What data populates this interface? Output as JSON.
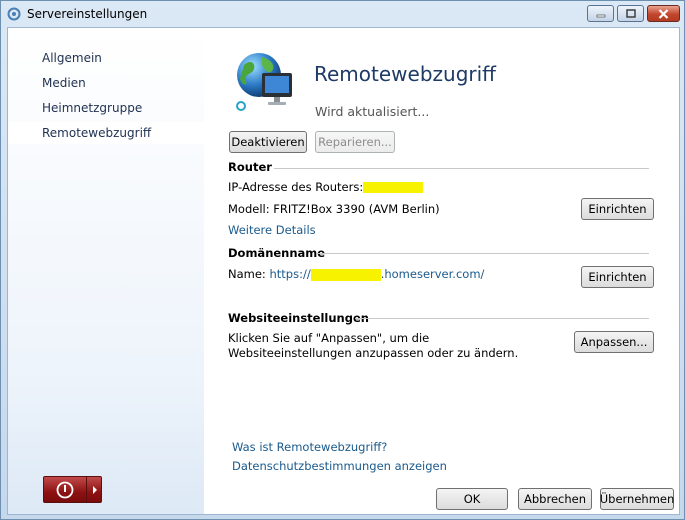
{
  "window": {
    "title": "Servereinstellungen"
  },
  "sidebar": {
    "items": [
      {
        "label": "Allgemein"
      },
      {
        "label": "Medien"
      },
      {
        "label": "Heimnetzgruppe"
      },
      {
        "label": "Remotewebzugriff"
      }
    ]
  },
  "main": {
    "heading": "Remotewebzugriff",
    "status": "Wird aktualisiert...",
    "buttons": {
      "deactivate": "Deaktivieren",
      "repair": "Reparieren..."
    },
    "router": {
      "title": "Router",
      "ip_label": "IP-Adresse des Routers:",
      "model_label": "Modell:",
      "model_value": "FRITZ!Box 3390 (AVM Berlin)",
      "setup_button": "Einrichten",
      "details_link": "Weitere Details"
    },
    "domain": {
      "title": "Domänenname",
      "name_label": "Name:",
      "name_prefix": "https://",
      "name_suffix": ".homeserver.com/",
      "setup_button": "Einrichten"
    },
    "website": {
      "title": "Websiteeinstellungen",
      "description": "Klicken Sie auf \"Anpassen\", um die Websiteeinstellungen anzupassen oder zu ändern.",
      "customize_button": "Anpassen..."
    },
    "links": {
      "what_is": "Was ist Remotewebzugriff?",
      "privacy": "Datenschutzbestimmungen anzeigen"
    }
  },
  "footer": {
    "ok": "OK",
    "cancel": "Abbrechen",
    "apply": "Übernehmen"
  },
  "colors": {
    "heading": "#1e3a66",
    "link": "#1a5a8c",
    "power_button": "#8e1212",
    "redaction": "#f7f200"
  }
}
